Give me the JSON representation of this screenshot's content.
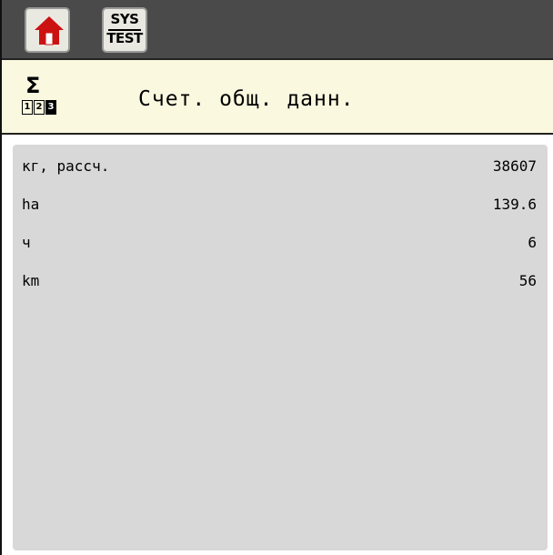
{
  "toolbar": {
    "home_icon": "home-icon",
    "systest": {
      "top": "SYS",
      "bottom": "TEST"
    }
  },
  "header": {
    "icon": "sum-counter-icon",
    "icon_sigma": "Σ",
    "icon_digits": [
      "1",
      "2",
      "3"
    ],
    "title": "Счет. общ. данн."
  },
  "rows": [
    {
      "label": "кг, рассч.",
      "value": "38607"
    },
    {
      "label": "ha",
      "value": "139.6"
    },
    {
      "label": "ч",
      "value": "6"
    },
    {
      "label": "km",
      "value": "56"
    }
  ],
  "colors": {
    "toolbar_bg": "#4a4a4a",
    "title_bg": "#fbf8e0",
    "panel_bg": "#d8d8d8",
    "home_red": "#cc1111"
  }
}
